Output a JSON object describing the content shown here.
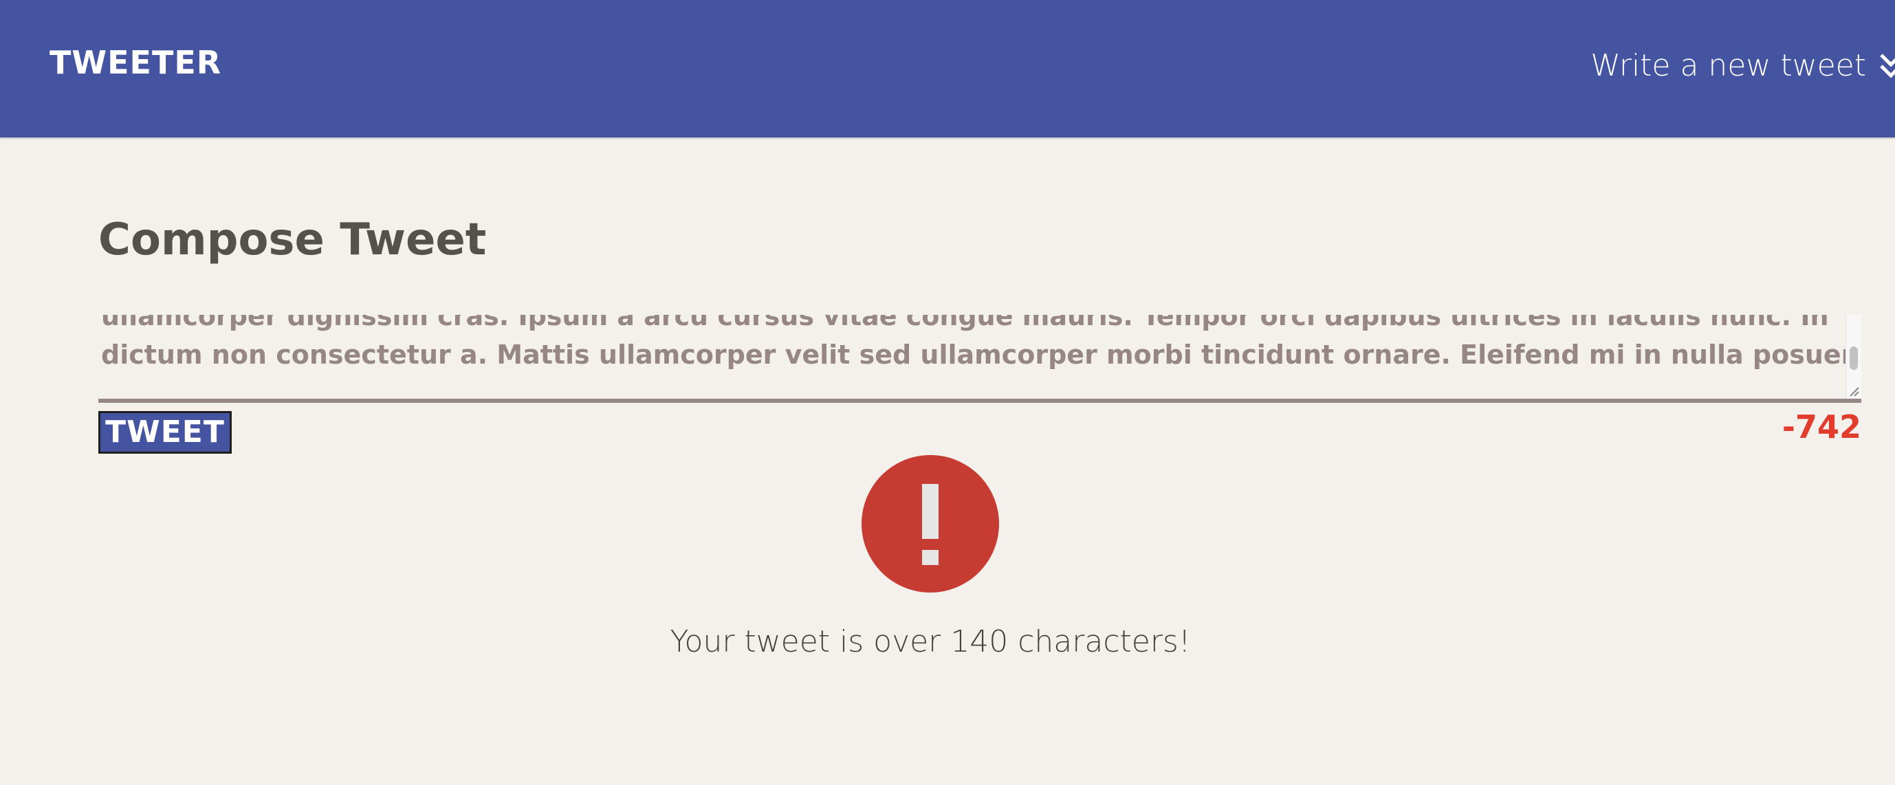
{
  "nav": {
    "brand": "TWEETER",
    "compose_link": "Write a new tweet",
    "compose_icon": "double-chevron-down-icon",
    "background_color": "#4454a0"
  },
  "composer": {
    "title": "Compose Tweet",
    "text_lines": [
      "ullamcorper dignissim cras. Ipsum a arcu cursus vitae congue mauris. Tempor orci dapibus ultrices in iaculis nunc. In",
      "dictum non consectetur a. Mattis ullamcorper velit sed ullamcorper morbi tincidunt ornare. Eleifend mi in nulla posuere."
    ],
    "tweet_button": "TWEET",
    "char_counter": "-742",
    "counter_color": "#e23d2c"
  },
  "error": {
    "icon": "exclamation-icon",
    "message": "Your tweet is over 140 characters!",
    "color": "#c63b32"
  }
}
